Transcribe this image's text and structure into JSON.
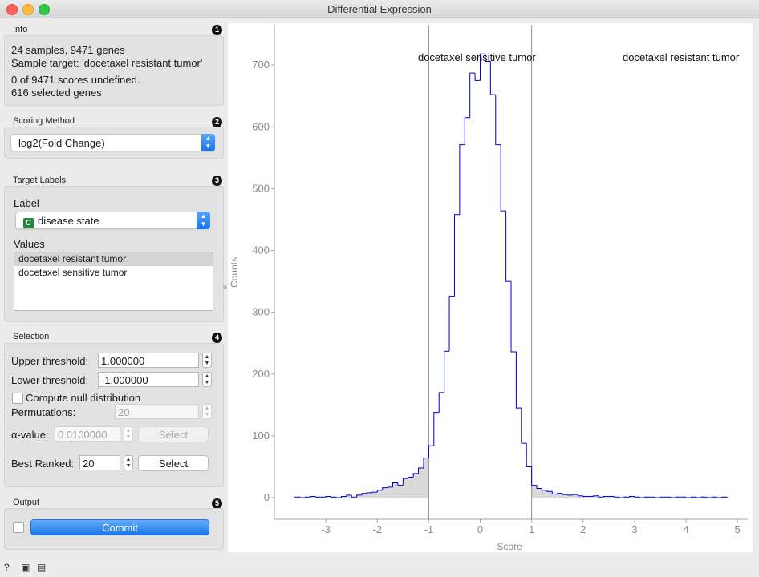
{
  "window": {
    "title": "Differential Expression"
  },
  "info": {
    "title": "Info",
    "badge": "1",
    "lines": [
      "24 samples, 9471 genes",
      "Sample target: 'docetaxel resistant tumor'",
      "0 of 9471 scores undefined.",
      "616 selected genes"
    ]
  },
  "scoring": {
    "title": "Scoring Method",
    "badge": "2",
    "method": "log2(Fold Change)"
  },
  "target": {
    "title": "Target Labels",
    "badge": "3",
    "label_caption": "Label",
    "label_value": "disease state",
    "label_type": "C",
    "values_caption": "Values",
    "values": [
      "docetaxel resistant tumor",
      "docetaxel sensitive tumor"
    ]
  },
  "selection": {
    "title": "Selection",
    "badge": "4",
    "upper_label": "Upper threshold:",
    "upper_value": "1.000000",
    "lower_label": "Lower threshold:",
    "lower_value": "-1.000000",
    "null_label": "Compute null distribution",
    "perm_label": "Permutations:",
    "perm_value": "20",
    "alpha_label": "α-value:",
    "alpha_value": "0.0100000",
    "select_label": "Select",
    "best_label": "Best Ranked:",
    "best_value": "20",
    "best_select_label": "Select"
  },
  "output": {
    "title": "Output",
    "badge": "5",
    "commit_label": "Commit"
  },
  "chart_data": {
    "type": "area",
    "xlabel": "Score",
    "ylabel": "Counts",
    "xlim": [
      -4.0,
      5.2
    ],
    "ylim": [
      -35,
      765
    ],
    "xticks": [
      -3,
      -2,
      -1,
      0,
      1,
      2,
      3,
      4,
      5
    ],
    "yticks": [
      0,
      100,
      200,
      300,
      400,
      500,
      600,
      700
    ],
    "thresholds": [
      -1,
      1
    ],
    "annotations": [
      "docetaxel sensitive tumor",
      "docetaxel resistant tumor"
    ],
    "line_color": "#0000cc",
    "fill_color": "#d9d9d9",
    "bin_width": 0.1,
    "x": [
      -3.6,
      -3.5,
      -3.4,
      -3.3,
      -3.2,
      -3.1,
      -3.0,
      -2.9,
      -2.8,
      -2.7,
      -2.6,
      -2.5,
      -2.4,
      -2.3,
      -2.2,
      -2.1,
      -2.0,
      -1.9,
      -1.8,
      -1.7,
      -1.6,
      -1.5,
      -1.4,
      -1.3,
      -1.2,
      -1.1,
      -1.0,
      -0.9,
      -0.8,
      -0.7,
      -0.6,
      -0.5,
      -0.4,
      -0.3,
      -0.2,
      -0.1,
      0.0,
      0.1,
      0.2,
      0.3,
      0.4,
      0.5,
      0.6,
      0.7,
      0.8,
      0.9,
      1.0,
      1.1,
      1.2,
      1.3,
      1.4,
      1.5,
      1.6,
      1.7,
      1.8,
      1.9,
      2.0,
      2.1,
      2.2,
      2.3,
      2.4,
      2.5,
      2.6,
      2.7,
      2.8,
      2.9,
      3.0,
      3.1,
      3.2,
      3.3,
      3.4,
      3.5,
      3.6,
      3.7,
      3.8,
      3.9,
      4.0,
      4.1,
      4.2,
      4.3,
      4.4,
      4.5,
      4.6,
      4.7
    ],
    "counts": [
      1,
      0,
      1,
      2,
      1,
      1,
      2,
      1,
      0,
      2,
      4,
      1,
      4,
      7,
      8,
      9,
      12,
      16,
      17,
      24,
      20,
      31,
      33,
      39,
      48,
      64,
      84,
      138,
      170,
      237,
      326,
      458,
      571,
      615,
      687,
      675,
      718,
      706,
      652,
      571,
      464,
      350,
      236,
      145,
      88,
      50,
      20,
      15,
      12,
      10,
      6,
      7,
      5,
      4,
      5,
      3,
      2,
      2,
      3,
      1,
      2,
      2,
      1,
      0,
      1,
      2,
      1,
      0,
      1,
      1,
      0,
      1,
      1,
      0,
      1,
      1,
      0,
      1,
      0,
      1,
      0,
      1,
      0,
      1
    ]
  }
}
